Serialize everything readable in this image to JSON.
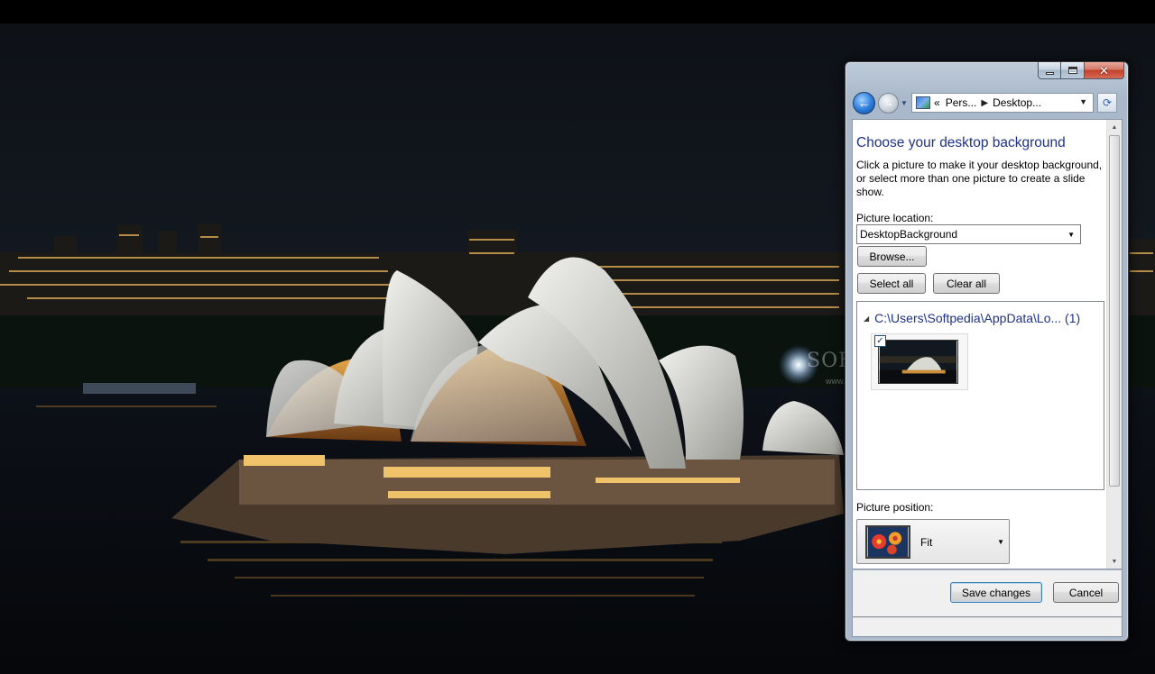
{
  "window": {
    "breadcrumb": [
      "Pers...",
      "Desktop..."
    ],
    "breadcrumb_prefix": "«",
    "title_heading": "Choose your desktop background",
    "description": "Click a picture to make it your desktop background, or select more than one picture to create a slide show.",
    "picture_location_label": "Picture location:",
    "picture_location_value": "DesktopBackground",
    "browse_label": "Browse...",
    "select_all_label": "Select all",
    "clear_all_label": "Clear all",
    "group_header": "C:\\Users\\Softpedia\\AppData\\Lo... (1)",
    "thumbnail_checked": "✓",
    "picture_position_label": "Picture position:",
    "picture_position_value": "Fit",
    "save_label": "Save changes",
    "cancel_label": "Cancel"
  },
  "wallpaper": {
    "watermark": "SOFTPEDIA",
    "watermark_sub": "www.softpedia.com"
  },
  "icons": [
    "back-arrow-icon",
    "forward-arrow-icon",
    "control-panel-icon",
    "refresh-icon",
    "minimize-icon",
    "maximize-icon",
    "close-icon"
  ],
  "colors": {
    "heading_blue": "#1e3287",
    "accent_button": "#3c7fb1"
  }
}
